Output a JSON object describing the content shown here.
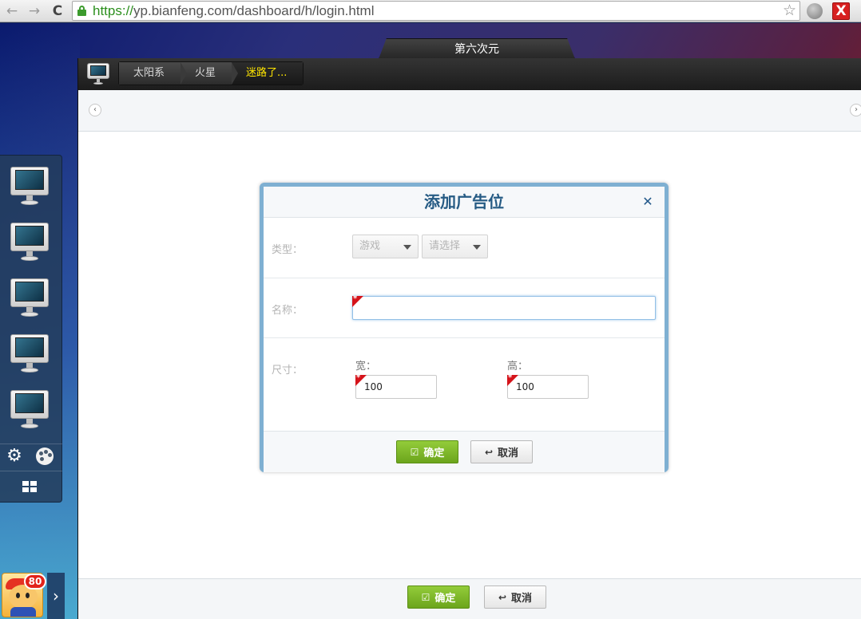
{
  "browser": {
    "url_scheme": "https://",
    "url_rest": "yp.bianfeng.com/dashboard/h/login.html",
    "back_glyph": "←",
    "forward_glyph": "→",
    "reload_glyph": "C",
    "bookmark_glyph": "☆",
    "close_glyph": "X",
    "icons": [
      "back-arrow-icon",
      "forward-arrow-icon",
      "reload-icon",
      "lock-icon",
      "bookmark-star-icon",
      "globe-icon",
      "close-x-icon"
    ]
  },
  "desktop": {
    "tab_title": "第六次元"
  },
  "app": {
    "breadcrumbs": [
      {
        "label": "太阳系"
      },
      {
        "label": "火星"
      },
      {
        "label": "迷路了..."
      }
    ],
    "scroll_left": "‹",
    "scroll_right": "›",
    "footer": {
      "confirm_label": "确定",
      "cancel_label": "取消"
    }
  },
  "dialog": {
    "title": "添加广告位",
    "close_glyph": "✕",
    "type_label": "类型：",
    "type_select_value": "游戏",
    "subtype_select_value": "请选择",
    "name_label": "名称：",
    "name_value": "",
    "size_label": "尺寸：",
    "width_label": "宽：",
    "width_value": "100",
    "height_label": "高：",
    "height_value": "100",
    "confirm_label": "确定",
    "cancel_label": "取消"
  },
  "dock": {
    "apps": [
      "monitor-icon",
      "monitor-icon",
      "monitor-icon",
      "monitor-icon",
      "monitor-icon"
    ],
    "tools": [
      "gear-icon",
      "palette-icon"
    ],
    "grid": "grid-icon",
    "gear_glyph": "⚙",
    "expand_glyph": "›"
  },
  "user": {
    "notification_count": "80"
  },
  "colors": {
    "accent_green": "#7ab62a",
    "dialog_title": "#265b84",
    "breadcrumb_active": "#ffe600",
    "required_marker": "#d5131a"
  }
}
